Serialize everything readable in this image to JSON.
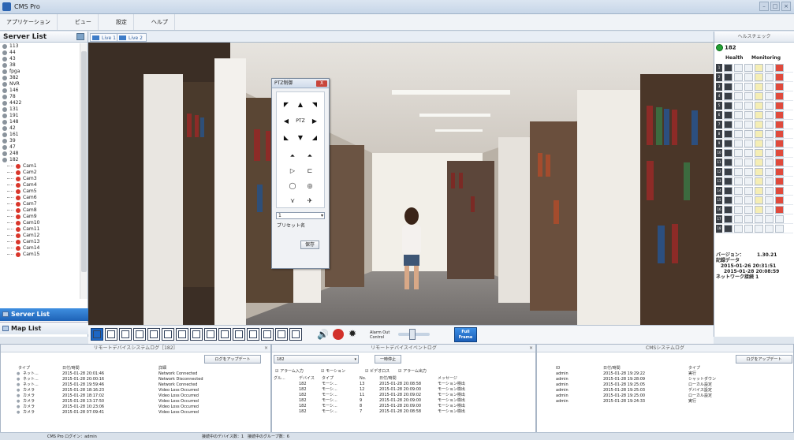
{
  "window": {
    "title": "CMS Pro"
  },
  "menu": [
    "アプリケーション",
    "ビュー",
    "設定",
    "ヘルプ"
  ],
  "left_panel": {
    "title": "Server List",
    "tree": [
      {
        "label": "113",
        "type": "server"
      },
      {
        "label": "44",
        "type": "server"
      },
      {
        "label": "43",
        "type": "server"
      },
      {
        "label": "38",
        "type": "server"
      },
      {
        "label": "fpga",
        "type": "server"
      },
      {
        "label": "382",
        "type": "server"
      },
      {
        "label": "NVR",
        "type": "server"
      },
      {
        "label": "146",
        "type": "server"
      },
      {
        "label": "78",
        "type": "server"
      },
      {
        "label": "4422",
        "type": "server"
      },
      {
        "label": "131",
        "type": "server"
      },
      {
        "label": "191",
        "type": "server"
      },
      {
        "label": "148",
        "type": "server"
      },
      {
        "label": "42",
        "type": "server"
      },
      {
        "label": "161",
        "type": "server"
      },
      {
        "label": "39",
        "type": "server"
      },
      {
        "label": "47",
        "type": "server"
      },
      {
        "label": "248",
        "type": "server"
      },
      {
        "label": "182",
        "type": "server"
      },
      {
        "label": "Cam1",
        "type": "camera"
      },
      {
        "label": "Cam2",
        "type": "camera"
      },
      {
        "label": "Cam3",
        "type": "camera"
      },
      {
        "label": "Cam4",
        "type": "camera"
      },
      {
        "label": "Cam5",
        "type": "camera"
      },
      {
        "label": "Cam6",
        "type": "camera"
      },
      {
        "label": "Cam7",
        "type": "camera"
      },
      {
        "label": "Cam8",
        "type": "camera"
      },
      {
        "label": "Cam9",
        "type": "camera"
      },
      {
        "label": "Cam10",
        "type": "camera"
      },
      {
        "label": "Cam11",
        "type": "camera"
      },
      {
        "label": "Cam12",
        "type": "camera"
      },
      {
        "label": "Cam13",
        "type": "camera"
      },
      {
        "label": "Cam14",
        "type": "camera"
      },
      {
        "label": "Cam15",
        "type": "camera"
      }
    ],
    "tab_server": "Server List",
    "tab_map": "Map List"
  },
  "video_tabs": [
    "Live 1",
    "Live 2"
  ],
  "ptz": {
    "title": "PTZ制御",
    "close": "X",
    "center_label": "PTZ",
    "select_value": "1",
    "preset_label": "プリセット名",
    "save_label": "保存"
  },
  "health": {
    "title": "ヘルスチェック",
    "server": "182",
    "col_health": "Health",
    "col_monitoring": "Monitoring",
    "rows": 18,
    "version_label": "バージョン：",
    "version_value": "1.30.21",
    "record_label": "記録データ",
    "record_from": "2015-01-26 20:31:51",
    "record_to": "2015-01-28 20:08:59",
    "network_label": "ネットワーク接続",
    "network_value": "1"
  },
  "toolbar": {
    "alarm_out": "Alarm Out Control",
    "full_frame": "Full Frame"
  },
  "panel_log": {
    "title": "リモートデバイスシステムログ［182］",
    "update_btn": "ログをアップデート",
    "cols": [
      "タイプ",
      "日付/時間",
      "詳細"
    ],
    "rows": [
      [
        "ネット...",
        "2015-01-28 20:01:46",
        "Network Connected"
      ],
      [
        "ネット...",
        "2015-01-28 20:00:16",
        "Network Disconnected"
      ],
      [
        "ネット...",
        "2015-01-28 19:59:46",
        "Network Connected"
      ],
      [
        "カメラ",
        "2015-01-28 18:16:23",
        "Video Loss Occurred"
      ],
      [
        "カメラ",
        "2015-01-28 18:17:02",
        "Video Loss Occurred"
      ],
      [
        "カメラ",
        "2015-01-28 13:17:50",
        "Video Loss Occurred"
      ],
      [
        "カメラ",
        "2015-01-28 10:23:06",
        "Video Loss Occurred"
      ],
      [
        "カメラ",
        "2015-01-28 07:09:41",
        "Video Loss Occurred"
      ]
    ]
  },
  "panel_event": {
    "title": "リモートデバイスイベントログ",
    "select_value": "182",
    "pause_btn": "一時停止",
    "checks": [
      "アラーム入力",
      "モーション",
      "ビデオロス",
      "アラーム出力"
    ],
    "cols": [
      "グル...",
      "デバイス",
      "タイプ",
      "No.",
      "日付/時間",
      "メッセージ"
    ],
    "rows": [
      [
        "182",
        "モーシ...",
        "13",
        "2015-01-28 20:08:58",
        "モーション検出"
      ],
      [
        "182",
        "モーシ...",
        "12",
        "2015-01-28 20:09:00",
        "モーション検出"
      ],
      [
        "182",
        "モーシ...",
        "11",
        "2015-01-28 20:09:02",
        "モーション検出"
      ],
      [
        "182",
        "モーシ...",
        "9",
        "2015-01-28 20:09:00",
        "モーション検出"
      ],
      [
        "182",
        "モーシ...",
        "8",
        "2015-01-28 20:09:00",
        "モーション検出"
      ],
      [
        "182",
        "モーシ...",
        "7",
        "2015-01-28 20:08:58",
        "モーション検出"
      ]
    ]
  },
  "panel_cms": {
    "title": "CMSシステムログ",
    "update_btn": "ログをアップデート",
    "cols": [
      "ID",
      "日付/時間",
      "タイプ"
    ],
    "rows": [
      [
        "admin",
        "2015-01-28 19:29:22",
        "実行"
      ],
      [
        "admin",
        "2015-01-28 19:28:09",
        "シャットダウン"
      ],
      [
        "admin",
        "2015-01-28 19:25:05",
        "ローカル設定"
      ],
      [
        "admin",
        "2015-01-28 19:25:03",
        "デバイス設定"
      ],
      [
        "admin",
        "2015-01-28 19:25:00",
        "ローカル設定"
      ],
      [
        "admin",
        "2015-01-28 19:24:33",
        "実行"
      ]
    ]
  },
  "status": {
    "login": "CMS Pro ログイン：admin",
    "devices": "接続中のデバイス数：1　接続中のグループ数：6"
  }
}
